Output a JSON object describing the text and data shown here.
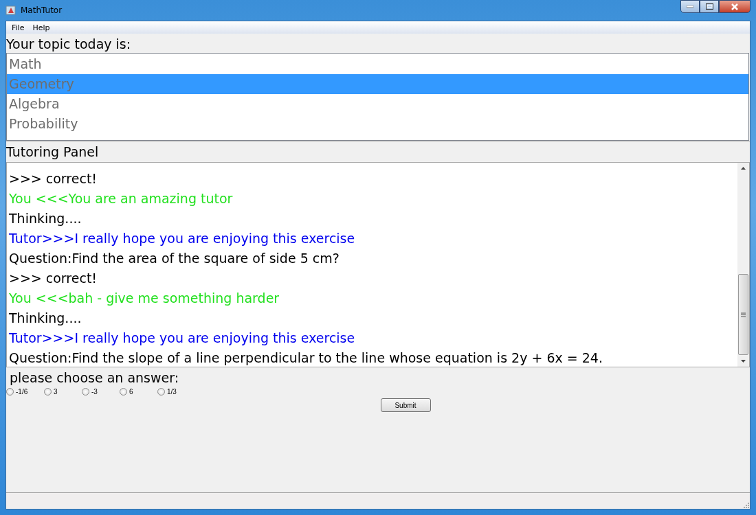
{
  "window": {
    "title": "MathTutor"
  },
  "menu": [
    "File",
    "Help"
  ],
  "topic": {
    "label": "Your topic today is:",
    "items": [
      {
        "label": "Math",
        "selected": false
      },
      {
        "label": "Geometry",
        "selected": true
      },
      {
        "label": "Algebra",
        "selected": false
      },
      {
        "label": "Probability",
        "selected": false
      }
    ]
  },
  "panel_title": "Tutoring Panel",
  "chat": [
    {
      "kind": "plain",
      "text": ">>> correct!"
    },
    {
      "kind": "you",
      "text": "You <<<You are an amazing tutor"
    },
    {
      "kind": "plain",
      "text": "Thinking...."
    },
    {
      "kind": "tutor",
      "text": "Tutor>>>I really hope you are enjoying this exercise"
    },
    {
      "kind": "plain",
      "text": "Question:Find the area of the square of side 5 cm?"
    },
    {
      "kind": "plain",
      "text": ">>> correct!"
    },
    {
      "kind": "you",
      "text": "You <<<bah - give me something harder"
    },
    {
      "kind": "plain",
      "text": "Thinking...."
    },
    {
      "kind": "tutor",
      "text": "Tutor>>>I really hope you are enjoying this exercise"
    },
    {
      "kind": "plain",
      "text": "Question:Find the slope of a line perpendicular to the line whose equation is 2y + 6x = 24."
    }
  ],
  "answer": {
    "prompt": "please choose an answer:",
    "options": [
      {
        "label": "-1/6",
        "selected": false
      },
      {
        "label": "3",
        "selected": false
      },
      {
        "label": "-3",
        "selected": false
      },
      {
        "label": "6",
        "selected": false
      },
      {
        "label": "1/3",
        "selected": false
      }
    ],
    "submit": "Submit"
  }
}
